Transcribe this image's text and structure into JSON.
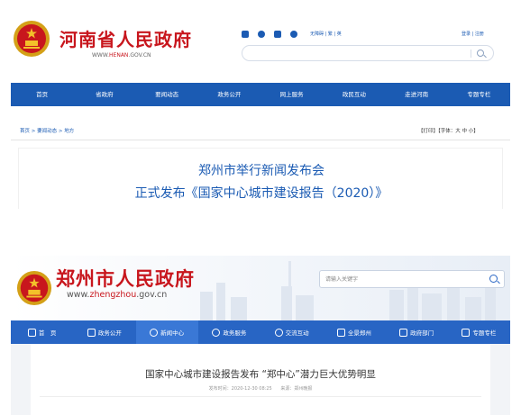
{
  "henan": {
    "site_title": "河南省人民政府",
    "url_prefix": "WWW.",
    "url_brand": "HENAN",
    "url_suffix": ".GOV.CN",
    "accessibility": "无障碍 | 繁 | 英",
    "login": "登录 | 注册",
    "search_placeholder": "",
    "nav": [
      "首页",
      "省政府",
      "要闻动态",
      "政务公开",
      "网上服务",
      "政民互动",
      "走进河南",
      "专题专栏"
    ],
    "breadcrumb": "首页 > 要闻动态 > 地方",
    "tools": "【打印】【字体：大 中 小】",
    "headline_line1": "郑州市举行新闻发布会",
    "headline_line2": "正式发布《国家中心城市建设报告（2020）》"
  },
  "zhengzhou": {
    "site_title": "郑州市人民政府",
    "url_prefix": "www.",
    "url_brand": "zhengzhou",
    "url_suffix": ".gov.cn",
    "search_placeholder": "请输入关键字",
    "nav": [
      {
        "label": "首　页",
        "icon": "home-icon"
      },
      {
        "label": "政务公开",
        "icon": "document-icon"
      },
      {
        "label": "新闻中心",
        "icon": "globe-icon"
      },
      {
        "label": "政务服务",
        "icon": "heart-icon"
      },
      {
        "label": "交流互动",
        "icon": "chat-icon"
      },
      {
        "label": "全景郑州",
        "icon": "map-icon"
      },
      {
        "label": "政府部门",
        "icon": "building-icon"
      },
      {
        "label": "专题专栏",
        "icon": "list-icon"
      }
    ],
    "headline": "国家中心城市建设报告发布 “郑中心”潜力巨大优势明显",
    "published": "发布时间：2020-12-30 08:25",
    "source": "来源：郑州晚报"
  },
  "colors": {
    "henan_red": "#c8161d",
    "henan_blue": "#1b5bb3",
    "zz_blue": "#2865c4"
  }
}
